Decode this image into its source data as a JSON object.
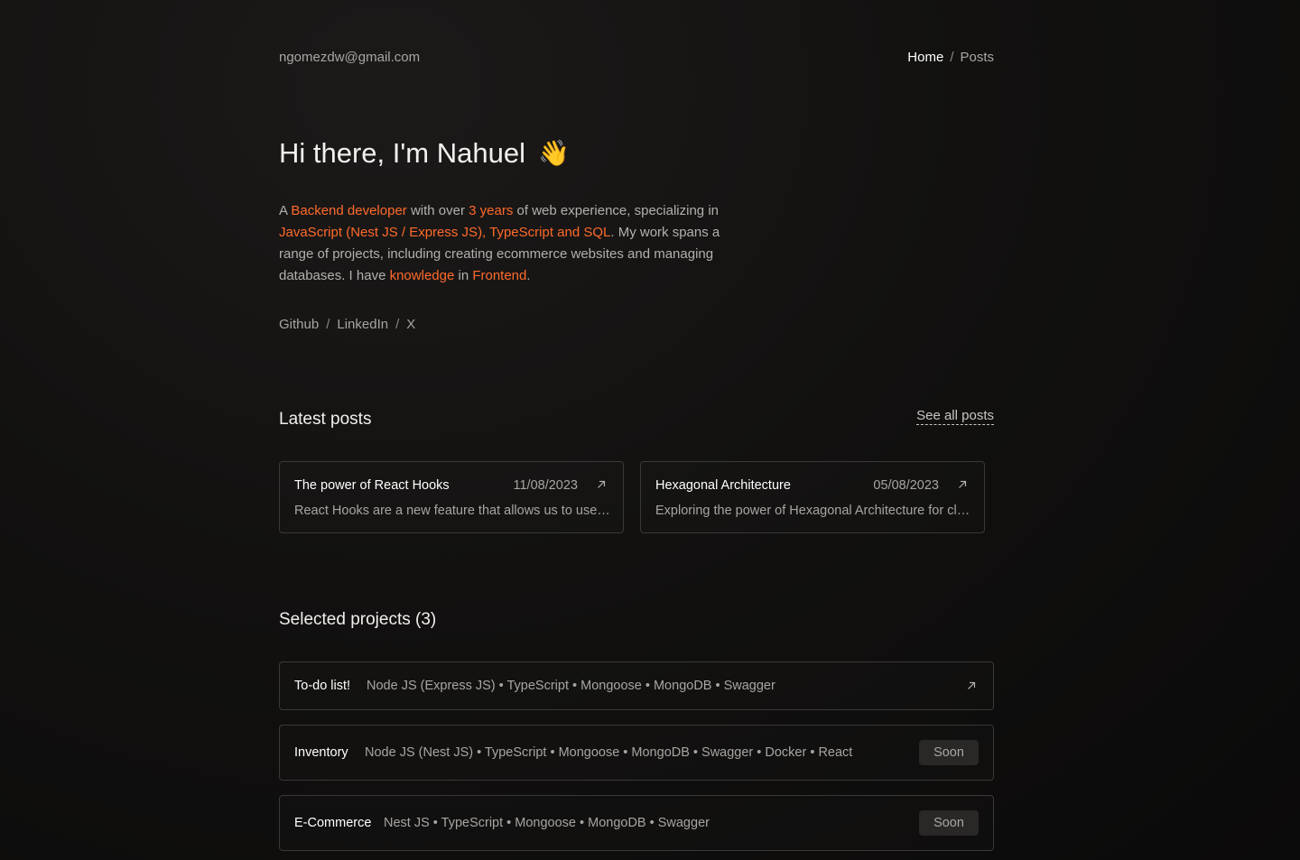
{
  "header": {
    "email": "ngomezdw@gmail.com",
    "nav": {
      "home": "Home",
      "separator": "/",
      "posts": "Posts"
    }
  },
  "hero": {
    "title": "Hi there, I'm Nahuel",
    "emoji": "👋",
    "bio": {
      "t1": "A ",
      "h1": "Backend developer",
      "t2": " with over ",
      "h2": "3 years",
      "t3": " of web experience, specializing in ",
      "h3": "JavaScript (Nest JS / Express JS), TypeScript and SQL",
      "t4": ". My work spans a range of projects, including creating ecommerce websites and managing databases. I have ",
      "h4": "knowledge",
      "t5": " in ",
      "h5": "Frontend",
      "t6": "."
    },
    "socials": {
      "github": "Github",
      "linkedin": "LinkedIn",
      "x": "X",
      "separator": "/"
    }
  },
  "posts": {
    "title": "Latest posts",
    "see_all": "See all posts",
    "items": [
      {
        "title": "The power of React Hooks",
        "date": "11/08/2023",
        "excerpt": "React Hooks are a new feature that allows us to use state and other React features without writing a class."
      },
      {
        "title": "Hexagonal Architecture",
        "date": "05/08/2023",
        "excerpt": "Exploring the power of Hexagonal Architecture for clean and maintainable code."
      }
    ]
  },
  "projects": {
    "title": "Selected projects (3)",
    "items": [
      {
        "name": "To-do list!",
        "stack": "Node JS (Express JS) • TypeScript • Mongoose • MongoDB • Swagger"
      },
      {
        "name": "Inventory",
        "stack": "Node JS (Nest JS) • TypeScript • Mongoose • MongoDB • Swagger • Docker • React",
        "badge": "Soon"
      },
      {
        "name": "E-Commerce",
        "stack": "Nest JS • TypeScript • Mongoose • MongoDB • Swagger",
        "badge": "Soon"
      }
    ]
  },
  "icons": {
    "external_link": "arrow-up-right-icon",
    "wave": "waving-hand-icon"
  },
  "colors": {
    "accent": "#ff6a2b",
    "background": "#121110",
    "border": "#3b3937"
  }
}
